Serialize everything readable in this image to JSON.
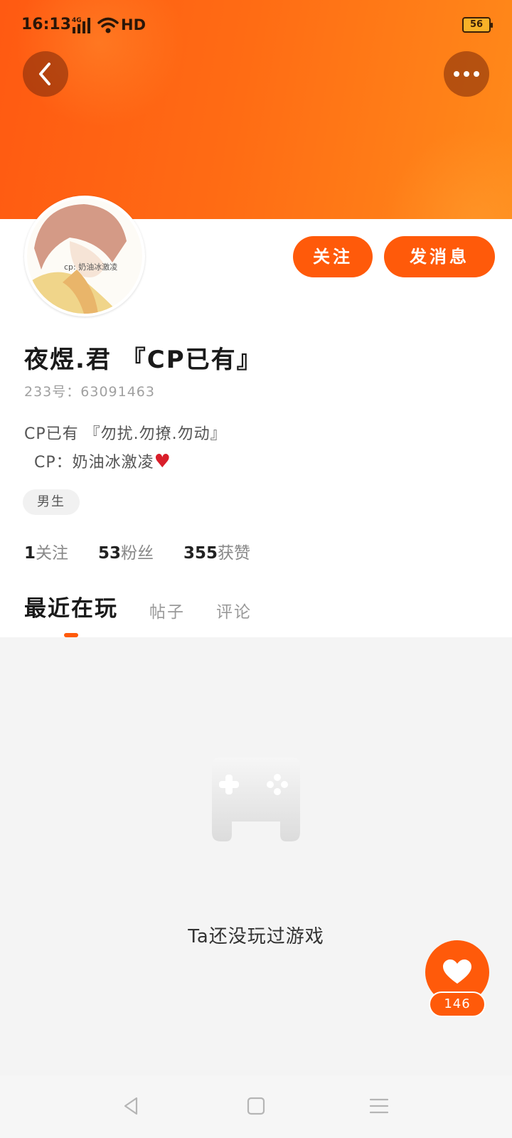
{
  "status_bar": {
    "time": "16:13",
    "network": "4G",
    "hd": "HD",
    "battery": "56"
  },
  "header": {
    "back_icon": "chevron-left-icon",
    "more_icon": "more-dots-icon"
  },
  "profile": {
    "avatar_text": "cp: 奶油冰激凌",
    "follow_label": "关注",
    "message_label": "发消息",
    "name": "夜煜.君 『CP已有』",
    "uid_label": "233号：",
    "uid": "63091463",
    "bio_line1": "CP已有 『勿扰.勿撩.勿动』",
    "bio_line2": "CP：奶油冰激凌",
    "bio_emoji": "♥",
    "gender_tag": "男生",
    "stats": {
      "following_count": "1",
      "following_label": "关注",
      "fans_count": "53",
      "fans_label": "粉丝",
      "likes_count": "355",
      "likes_label": "获赞"
    }
  },
  "tabs": [
    {
      "label": "最近在玩",
      "active": true
    },
    {
      "label": "帖子",
      "active": false
    },
    {
      "label": "评论",
      "active": false
    }
  ],
  "empty_state": {
    "icon": "gamepad-icon",
    "text": "Ta还没玩过游戏"
  },
  "like_fab": {
    "icon": "heart-icon",
    "count": "146"
  },
  "colors": {
    "accent": "#ff5a0a",
    "banner_start": "#ff5a12",
    "banner_end": "#ff8a1a"
  }
}
